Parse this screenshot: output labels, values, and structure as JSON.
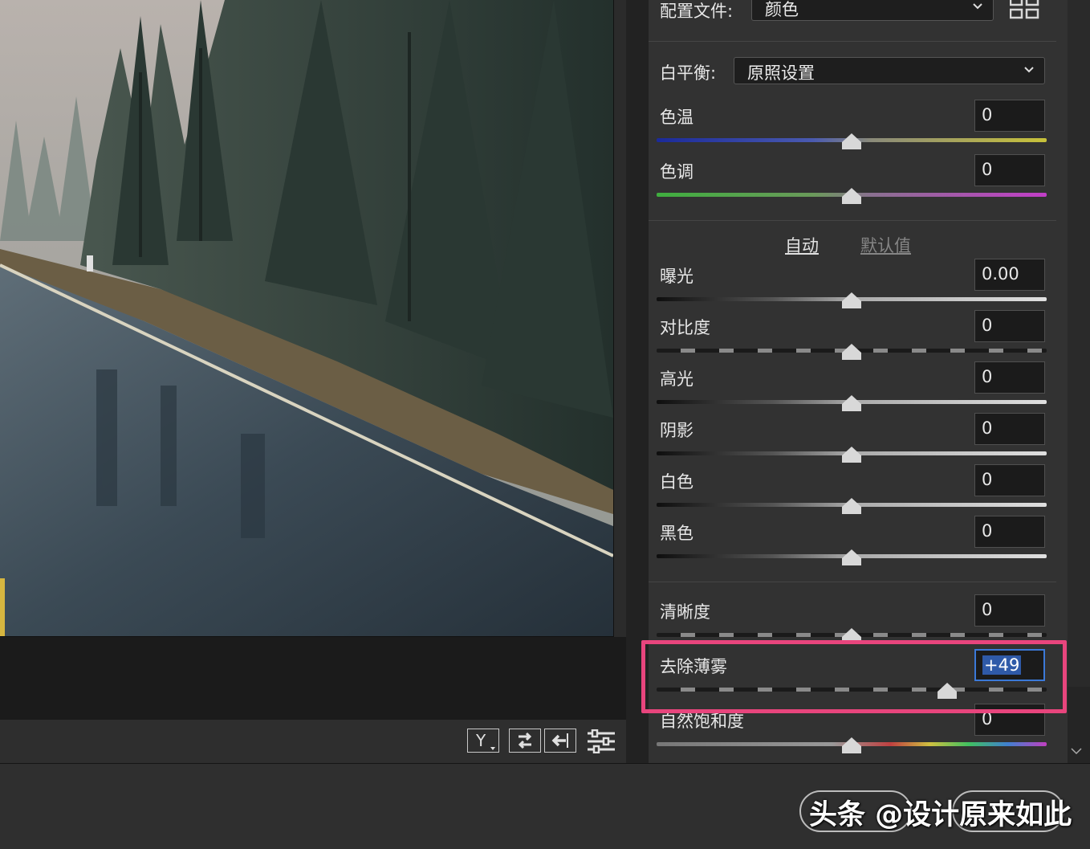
{
  "panel": {
    "profile": {
      "label": "配置文件:",
      "value": "颜色"
    },
    "white_balance": {
      "label": "白平衡:",
      "value": "原照设置"
    },
    "auto_label": "自动",
    "default_label": "默认值",
    "sliders": [
      {
        "label": "色温",
        "value": "0",
        "level": 0.5
      },
      {
        "label": "色调",
        "value": "0",
        "level": 0.5
      },
      {
        "label": "曝光",
        "value": "0.00",
        "level": 0.5
      },
      {
        "label": "对比度",
        "value": "0",
        "level": 0.5
      },
      {
        "label": "高光",
        "value": "0",
        "level": 0.5
      },
      {
        "label": "阴影",
        "value": "0",
        "level": 0.5
      },
      {
        "label": "白色",
        "value": "0",
        "level": 0.5
      },
      {
        "label": "黑色",
        "value": "0",
        "level": 0.5
      },
      {
        "label": "清晰度",
        "value": "0",
        "level": 0.5
      },
      {
        "label": "去除薄雾",
        "value": "+49",
        "level": 0.745,
        "selected": true
      },
      {
        "label": "自然饱和度",
        "value": "0",
        "level": 0.5
      }
    ]
  },
  "toolbar": {
    "icons": [
      "y-compare-icon",
      "swap-icon",
      "copy-settings-icon",
      "sliders-icon"
    ]
  },
  "watermark": "头条 @设计原来如此",
  "colors": {
    "highlight": "#e8457d",
    "selection": "#2f5aa8"
  }
}
